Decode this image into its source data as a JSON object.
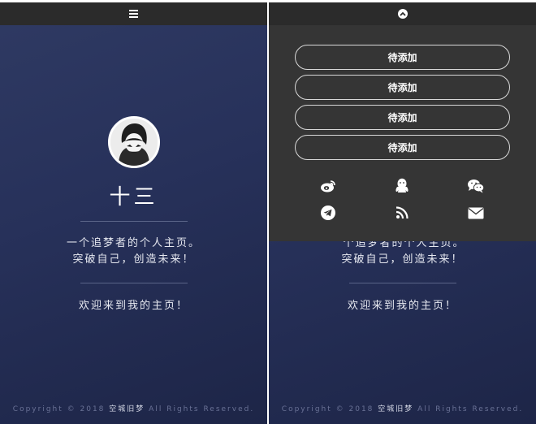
{
  "left": {
    "profile_name": "十三",
    "intro_line1": "一个追梦者的个人主页。",
    "intro_line2": "突破自己，创造未来！",
    "welcome": "欢迎来到我的主页！",
    "footer": {
      "copyright": "Copyright © 2018",
      "owner": "空城旧梦",
      "rights": "All Rights Reserved."
    }
  },
  "right": {
    "intro_line1_partial": "个追梦者的个人主页。",
    "intro_line2": "突破自己，创造未来！",
    "welcome": "欢迎来到我的主页！",
    "footer": {
      "copyright": "Copyright © 2018",
      "owner": "空城旧梦",
      "rights": "All Rights Reserved."
    },
    "menu": {
      "buttons": [
        {
          "label": "待添加"
        },
        {
          "label": "待添加"
        },
        {
          "label": "待添加"
        },
        {
          "label": "待添加"
        }
      ],
      "social_icons": [
        "weibo-icon",
        "qq-icon",
        "wechat-icon",
        "telegram-icon",
        "rss-icon",
        "mail-icon"
      ]
    }
  },
  "colors": {
    "topbar": "#2b2b2b",
    "dropdown_bg": "#353535",
    "gradient_top": "#2f3a63",
    "gradient_bottom": "#1d2547",
    "text": "#ffffff"
  }
}
